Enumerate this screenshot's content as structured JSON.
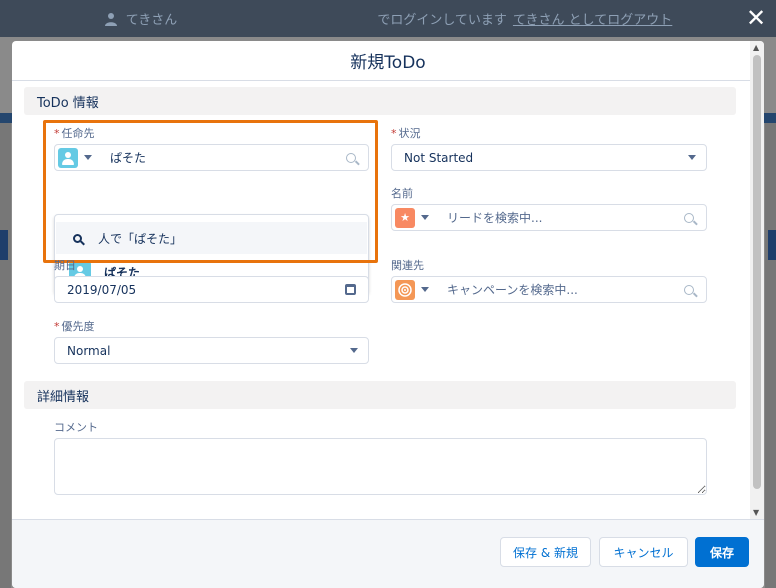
{
  "banner": {
    "user_prefix": "てきさん",
    "login_text": "でログインしています",
    "logout_link": "てきさん としてログアウト"
  },
  "modal": {
    "title": "新規ToDo",
    "section_todo": "ToDo 情報",
    "section_detail": "詳細情報",
    "assignee": {
      "label": "任命先",
      "value": "ぱそた",
      "dropdown_search_text": "人で「ぱそた」",
      "dropdown_result": "ぱそた"
    },
    "status": {
      "label": "状況",
      "value": "Not Started"
    },
    "name": {
      "label": "名前",
      "placeholder": "リードを検索中..."
    },
    "due_date": {
      "label": "期日",
      "value": "2019/07/05"
    },
    "related_to": {
      "label": "関連先",
      "placeholder": "キャンペーンを検索中..."
    },
    "priority": {
      "label": "優先度",
      "value": "Normal"
    },
    "comment": {
      "label": "コメント",
      "value": ""
    }
  },
  "footer": {
    "save_new": "保存 & 新規",
    "cancel": "キャンセル",
    "save": "保存"
  },
  "colors": {
    "brand": "#0070d2",
    "highlight": "#e8730c",
    "user_icon": "#65cae4",
    "lead_icon": "#f88962",
    "campaign_icon": "#f49756"
  },
  "icons": {
    "user": "user-icon",
    "lead": "lead-star-icon",
    "campaign": "campaign-target-icon",
    "search": "search-icon",
    "calendar": "calendar-icon",
    "close": "close-icon"
  }
}
